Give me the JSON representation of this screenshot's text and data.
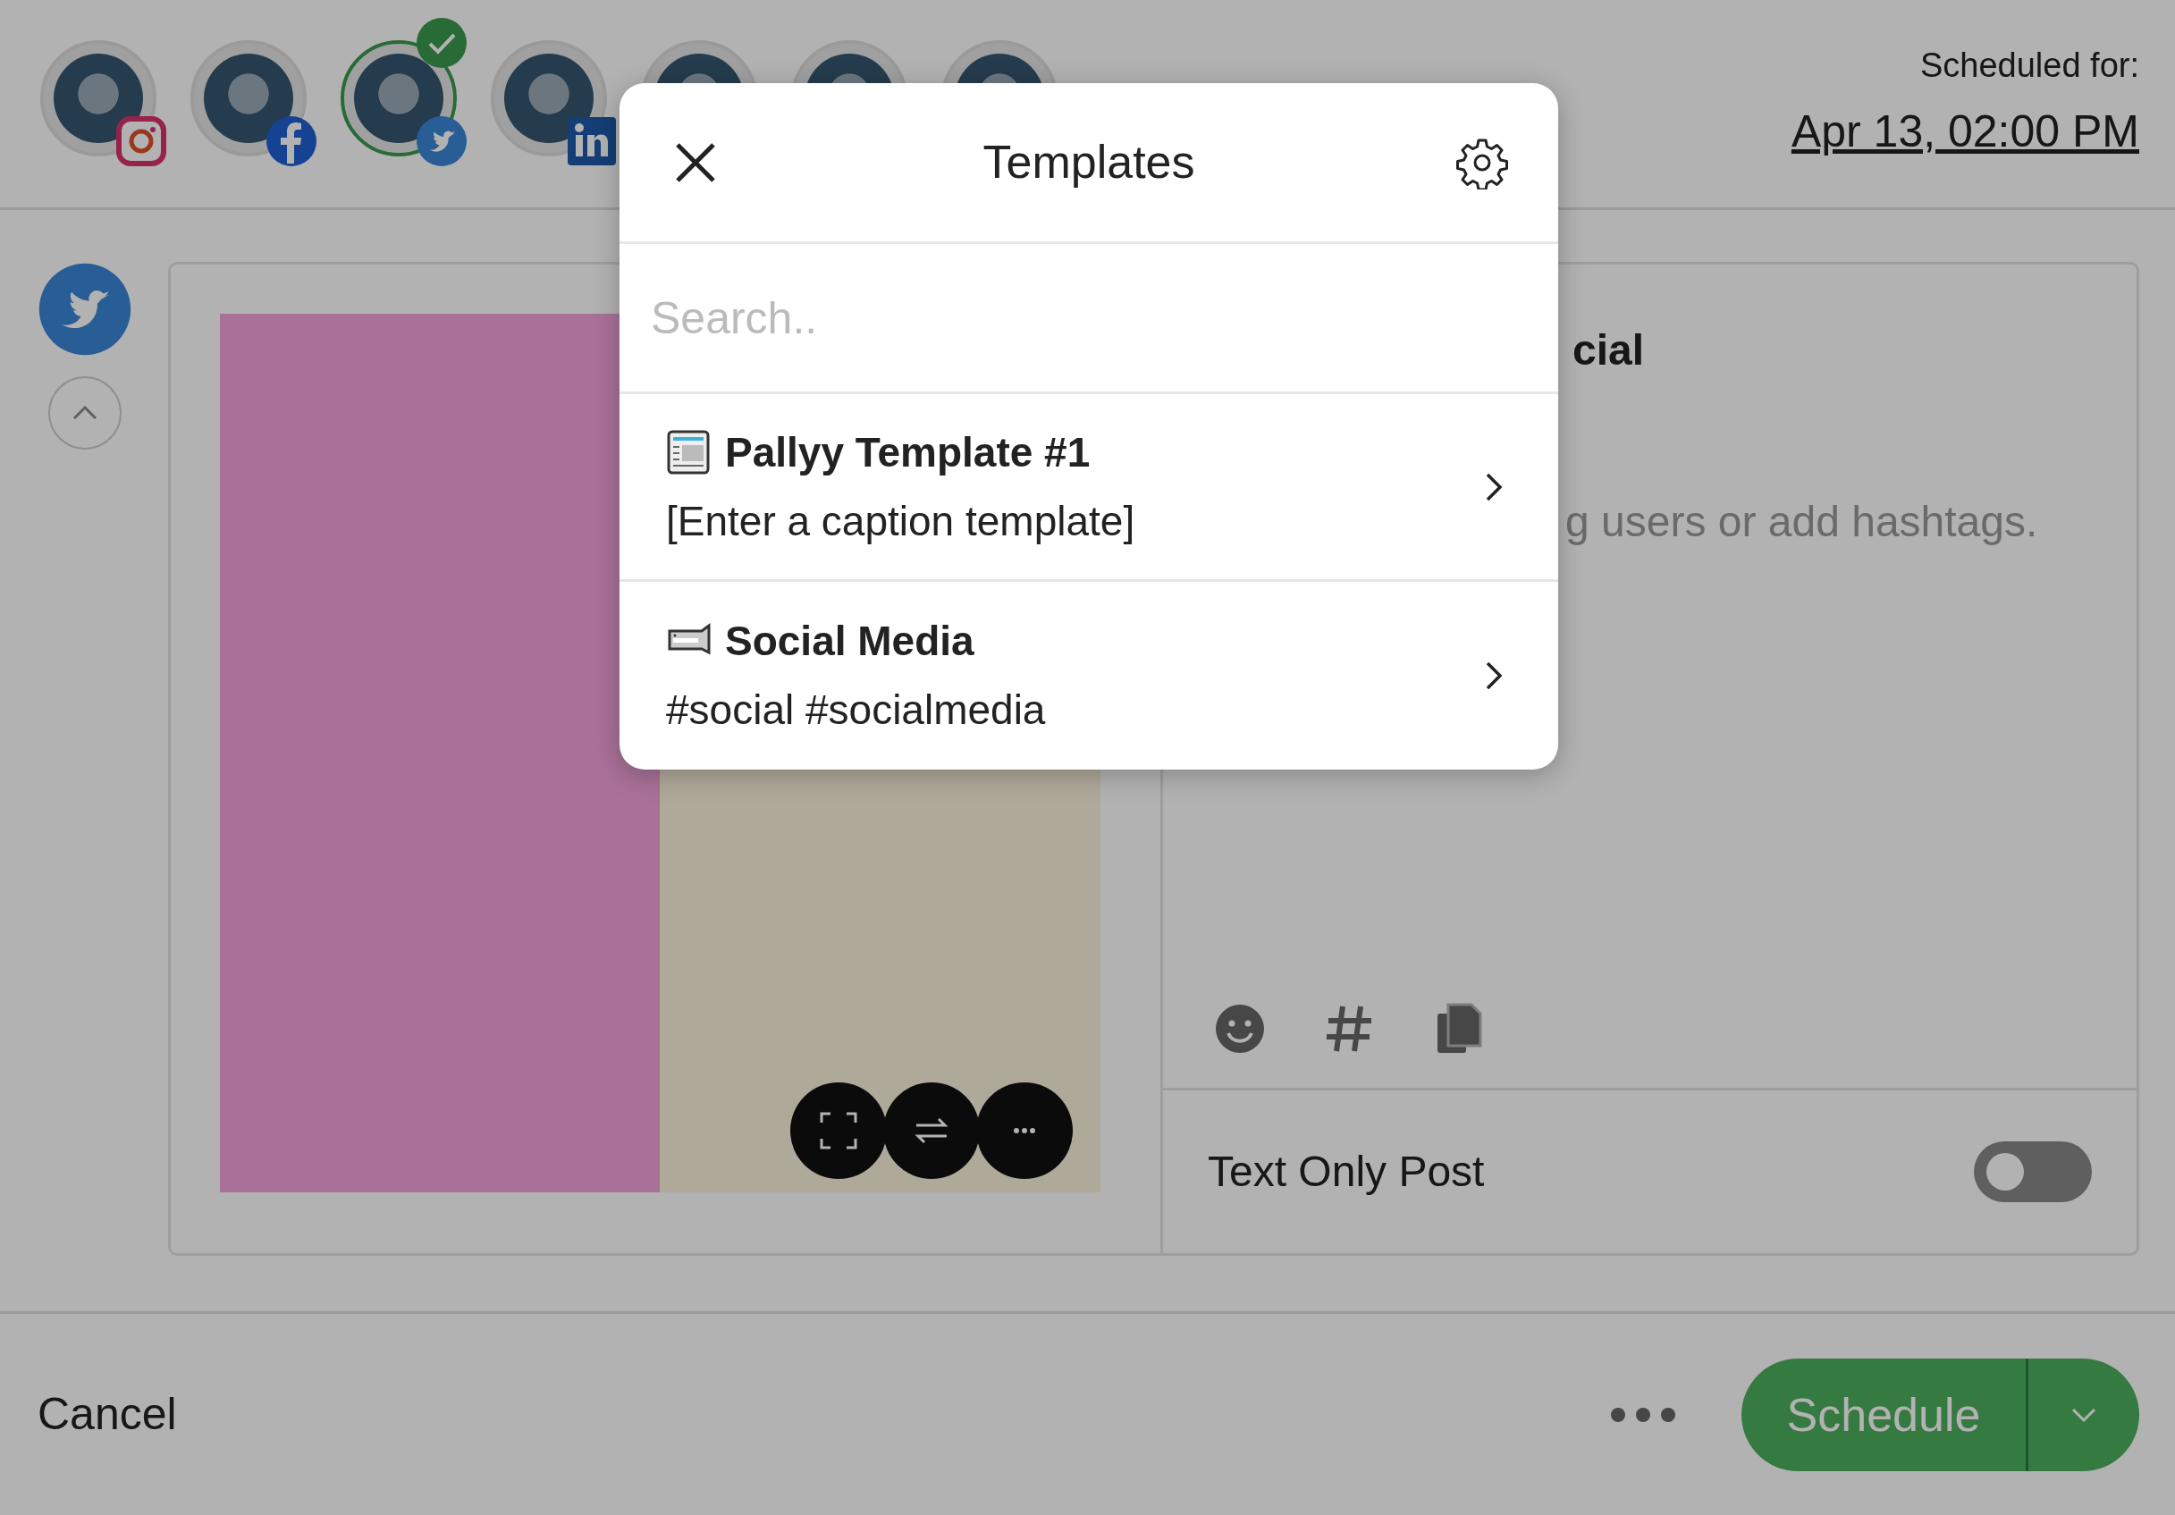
{
  "accounts": [
    {
      "kind": "instagram",
      "selected": false
    },
    {
      "kind": "facebook",
      "selected": false
    },
    {
      "kind": "twitter",
      "selected": true
    },
    {
      "kind": "linkedin",
      "selected": false
    },
    {
      "selected": false
    },
    {
      "selected": false
    },
    {
      "selected": false
    }
  ],
  "schedule": {
    "label": "Scheduled for:",
    "date": "Apr 13, 02:00 PM"
  },
  "editor": {
    "heading_fragment": "cial",
    "placeholder_fragment": "g users or add hashtags.",
    "text_only_label": "Text Only Post",
    "text_only_on": false
  },
  "footer": {
    "cancel": "Cancel",
    "schedule": "Schedule"
  },
  "modal": {
    "title": "Templates",
    "search_placeholder": "Search..",
    "templates": [
      {
        "title": "Pallyy Template #1",
        "body": "[Enter a caption template]"
      },
      {
        "title": "Social Media",
        "body": "#social #socialmedia"
      }
    ]
  }
}
